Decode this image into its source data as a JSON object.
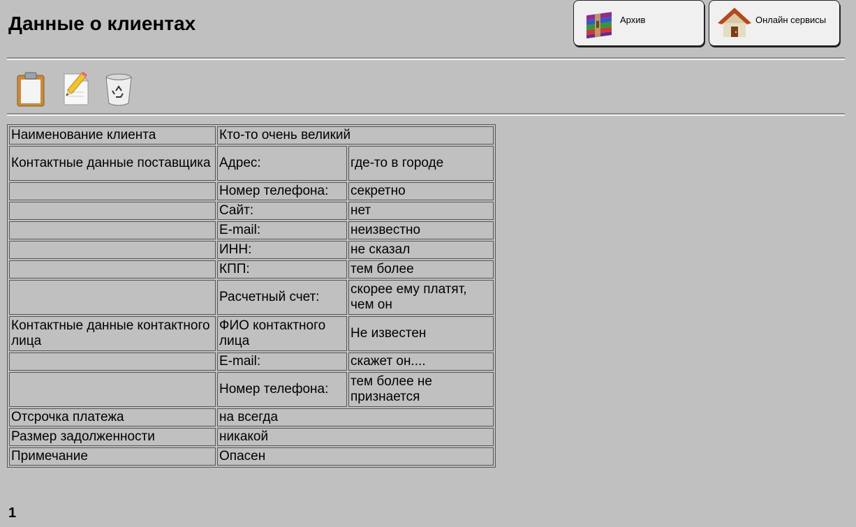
{
  "header": {
    "title": "Данные о клиентах",
    "archive_button": {
      "label": "Архив",
      "icon": "archive-icon"
    },
    "online_button": {
      "label": "Онлайн сервисы",
      "icon": "home-icon"
    }
  },
  "toolbar": {
    "tools": [
      {
        "icon": "clipboard-icon"
      },
      {
        "icon": "edit-document-icon"
      },
      {
        "icon": "trash-icon"
      }
    ]
  },
  "client": {
    "name": {
      "label": "Наименование клиента",
      "value": "Кто-то очень великий"
    },
    "supplier_contacts": {
      "label": "Контактные данные поставщика",
      "rows": [
        {
          "label": "Адрес:",
          "value": "где-то в городе"
        },
        {
          "label": "Номер телефона:",
          "value": "секретно"
        },
        {
          "label": "Сайт:",
          "value": "нет"
        },
        {
          "label": "E-mail:",
          "value": "неизвестно"
        },
        {
          "label": "ИНН:",
          "value": "не сказал"
        },
        {
          "label": "КПП:",
          "value": "тем более"
        },
        {
          "label": "Расчетный счет:",
          "value": "скорее ему платят, чем он"
        }
      ]
    },
    "contact_person": {
      "label": "Контактные данные контактного лица",
      "rows": [
        {
          "label": "ФИО контактного лица",
          "value": "Не известен"
        },
        {
          "label": "E-mail:",
          "value": "скажет он...."
        },
        {
          "label": "Номер телефона:",
          "value": "тем более не признается"
        }
      ]
    },
    "payment_delay": {
      "label": "Отсрочка платежа",
      "value": "на всегда"
    },
    "debt": {
      "label": "Размер задолженности",
      "value": "никакой"
    },
    "note": {
      "label": "Примечание",
      "value": "Опасен"
    }
  },
  "pagination": {
    "page": "1"
  }
}
